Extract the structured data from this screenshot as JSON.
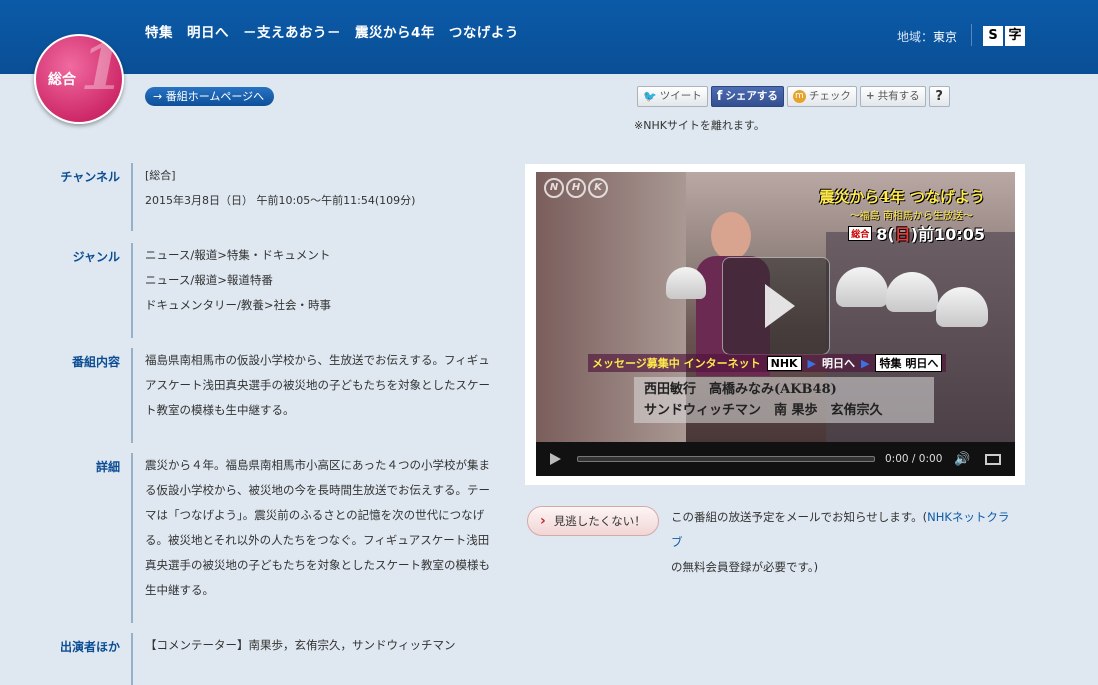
{
  "header": {
    "program_title": "特集　明日へ　－支えあおう－　震災から4年　つなげよう",
    "region_label": "地域：",
    "region_value": "東京",
    "subtitle_buttons": [
      "S",
      "字"
    ]
  },
  "channel_badge": {
    "label": "総合",
    "number": "1",
    "color": "#cf2a6a"
  },
  "homepage_button": "→ 番組ホームページへ",
  "share": {
    "tweet": "ツイート",
    "facebook": "シェアする",
    "mixi": "チェック",
    "share": "共有する",
    "help": "?",
    "note": "※NHKサイトを離れます。"
  },
  "info": {
    "channel": {
      "label": "チャンネル",
      "lines": [
        "[総合]",
        "2015年3月8日（日） 午前10:05～午前11:54(109分)"
      ]
    },
    "genre": {
      "label": "ジャンル",
      "lines": [
        "ニュース/報道>特集・ドキュメント",
        "ニュース/報道>報道特番",
        "ドキュメンタリー/教養>社会・時事"
      ]
    },
    "content": {
      "label": "番組内容",
      "lines": [
        "福島県南相馬市の仮設小学校から、生放送でお伝えする。フィギュ",
        "アスケート浅田真央選手の被災地の子どもたちを対象としたスケー",
        "ト教室の模様も生中継する。"
      ]
    },
    "detail": {
      "label": "詳細",
      "lines": [
        "震災から４年。福島県南相馬市小高区にあった４つの小学校が集ま",
        "る仮設小学校から、被災地の今を長時間生放送でお伝えする。テー",
        "マは「つなげよう」。震災前のふるさとの記憶を次の世代につなげ",
        "る。被災地とそれ以外の人たちをつなぐ。フィギュアスケート浅田",
        "真央選手の被災地の子どもたちを対象としたスケート教室の模様も",
        "生中継する。"
      ]
    },
    "cast": {
      "label": "出演者ほか",
      "lines": [
        "【コメンテーター】南果歩，玄侑宗久，サンドウィッチマン"
      ]
    }
  },
  "video": {
    "logo": [
      "N",
      "H",
      "K"
    ],
    "title": "震災から4年 つなげよう",
    "subtitle": "～福島 南相馬から生放送～",
    "chip": "総合",
    "time_date": "8(",
    "time_day": "日",
    "time_rest": ")前10:05",
    "msg_lead": "メッセージ募集中 インターネット",
    "msg_nhk": "NHK",
    "msg_ashita": "明日へ",
    "msg_special": "特集 明日へ",
    "cast_line1": "西田敏行　高橋みなみ(AKB48)",
    "cast_line2": "サンドウィッチマン　南 果歩　玄侑宗久",
    "time_display": "0:00 / 0:00"
  },
  "reminder": {
    "button": "見逃したくない！",
    "text_before": "この番組の放送予定をメールでお知らせします。(",
    "link": "NHKネットクラブ",
    "text_after": "の無料会員登録が必要です。)"
  }
}
